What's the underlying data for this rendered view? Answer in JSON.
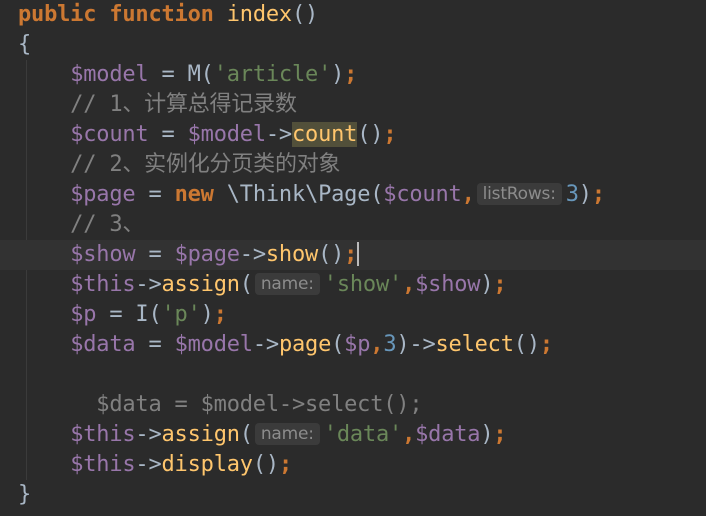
{
  "editor": {
    "colors": {
      "background": "#2b2b2b",
      "current_line": "#323232",
      "keyword": "#cc7832",
      "function": "#ffc66d",
      "variable": "#9876aa",
      "string": "#6a8759",
      "number": "#6897bb",
      "comment": "#808080",
      "text": "#a9b7c6"
    },
    "lines": [
      {
        "tokens": [
          {
            "t": "public",
            "c": "kw"
          },
          {
            "t": " ",
            "c": "plain"
          },
          {
            "t": "function",
            "c": "kw"
          },
          {
            "t": " ",
            "c": "plain"
          },
          {
            "t": "index",
            "c": "fn"
          },
          {
            "t": "()",
            "c": "punc"
          }
        ]
      },
      {
        "tokens": [
          {
            "t": "{",
            "c": "punc"
          }
        ]
      },
      {
        "tokens": [
          {
            "t": "    ",
            "c": "plain"
          },
          {
            "t": "$model",
            "c": "var"
          },
          {
            "t": " = ",
            "c": "op"
          },
          {
            "t": "M(",
            "c": "plain"
          },
          {
            "t": "'article'",
            "c": "str"
          },
          {
            "t": ")",
            "c": "plain"
          },
          {
            "t": ";",
            "c": "kw"
          }
        ]
      },
      {
        "tokens": [
          {
            "t": "    // 1、计算总得记录数",
            "c": "comment"
          }
        ]
      },
      {
        "tokens": [
          {
            "t": "    ",
            "c": "plain"
          },
          {
            "t": "$count",
            "c": "var"
          },
          {
            "t": " = ",
            "c": "op"
          },
          {
            "t": "$model",
            "c": "var"
          },
          {
            "t": "->",
            "c": "op"
          },
          {
            "t": "count",
            "c": "fn",
            "hl": true
          },
          {
            "t": "()",
            "c": "punc"
          },
          {
            "t": ";",
            "c": "kw"
          }
        ]
      },
      {
        "tokens": [
          {
            "t": "    // 2、实例化分页类的对象",
            "c": "comment"
          }
        ]
      },
      {
        "tokens": [
          {
            "t": "    ",
            "c": "plain"
          },
          {
            "t": "$page",
            "c": "var"
          },
          {
            "t": " = ",
            "c": "op"
          },
          {
            "t": "new",
            "c": "kw"
          },
          {
            "t": " \\Think\\Page(",
            "c": "plain"
          },
          {
            "t": "$count",
            "c": "var"
          },
          {
            "t": ",",
            "c": "kw"
          },
          {
            "hint": "listRows:"
          },
          {
            "t": "3",
            "c": "num"
          },
          {
            "t": ")",
            "c": "plain"
          },
          {
            "t": ";",
            "c": "kw"
          }
        ]
      },
      {
        "tokens": [
          {
            "t": "    // 3、",
            "c": "comment"
          }
        ]
      },
      {
        "current": true,
        "tokens": [
          {
            "t": "    ",
            "c": "plain"
          },
          {
            "t": "$show",
            "c": "var"
          },
          {
            "t": " = ",
            "c": "op"
          },
          {
            "t": "$page",
            "c": "var"
          },
          {
            "t": "->",
            "c": "op"
          },
          {
            "t": "show",
            "c": "fn"
          },
          {
            "t": "()",
            "c": "punc"
          },
          {
            "t": ";",
            "c": "kw"
          },
          {
            "caret": true
          }
        ]
      },
      {
        "tokens": [
          {
            "t": "    ",
            "c": "plain"
          },
          {
            "t": "$this",
            "c": "var"
          },
          {
            "t": "->",
            "c": "op"
          },
          {
            "t": "assign",
            "c": "fn"
          },
          {
            "t": "(",
            "c": "punc"
          },
          {
            "hint": "name:"
          },
          {
            "t": "'show'",
            "c": "str"
          },
          {
            "t": ",",
            "c": "kw"
          },
          {
            "t": "$show",
            "c": "var"
          },
          {
            "t": ")",
            "c": "plain"
          },
          {
            "t": ";",
            "c": "kw"
          }
        ]
      },
      {
        "tokens": [
          {
            "t": "    ",
            "c": "plain"
          },
          {
            "t": "$p",
            "c": "var"
          },
          {
            "t": " = ",
            "c": "op"
          },
          {
            "t": "I(",
            "c": "plain"
          },
          {
            "t": "'p'",
            "c": "str"
          },
          {
            "t": ")",
            "c": "plain"
          },
          {
            "t": ";",
            "c": "kw"
          }
        ]
      },
      {
        "tokens": [
          {
            "t": "    ",
            "c": "plain"
          },
          {
            "t": "$data",
            "c": "var"
          },
          {
            "t": " = ",
            "c": "op"
          },
          {
            "t": "$model",
            "c": "var"
          },
          {
            "t": "->",
            "c": "op"
          },
          {
            "t": "page",
            "c": "fn"
          },
          {
            "t": "(",
            "c": "punc"
          },
          {
            "t": "$p",
            "c": "var"
          },
          {
            "t": ",",
            "c": "kw"
          },
          {
            "t": "3",
            "c": "num"
          },
          {
            "t": ")->",
            "c": "op"
          },
          {
            "t": "select",
            "c": "fn"
          },
          {
            "t": "()",
            "c": "punc"
          },
          {
            "t": ";",
            "c": "kw"
          }
        ]
      },
      {
        "tokens": []
      },
      {
        "tokens": [
          {
            "t": "      $data = $model->select();",
            "c": "comment"
          }
        ]
      },
      {
        "tokens": [
          {
            "t": "    ",
            "c": "plain"
          },
          {
            "t": "$this",
            "c": "var"
          },
          {
            "t": "->",
            "c": "op"
          },
          {
            "t": "assign",
            "c": "fn"
          },
          {
            "t": "(",
            "c": "punc"
          },
          {
            "hint": "name:"
          },
          {
            "t": "'data'",
            "c": "str"
          },
          {
            "t": ",",
            "c": "kw"
          },
          {
            "t": "$data",
            "c": "var"
          },
          {
            "t": ")",
            "c": "plain"
          },
          {
            "t": ";",
            "c": "kw"
          }
        ]
      },
      {
        "tokens": [
          {
            "t": "    ",
            "c": "plain"
          },
          {
            "t": "$this",
            "c": "var"
          },
          {
            "t": "->",
            "c": "op"
          },
          {
            "t": "display",
            "c": "fn"
          },
          {
            "t": "()",
            "c": "punc"
          },
          {
            "t": ";",
            "c": "kw"
          }
        ]
      },
      {
        "tokens": [
          {
            "t": "}",
            "c": "punc"
          }
        ]
      }
    ]
  }
}
